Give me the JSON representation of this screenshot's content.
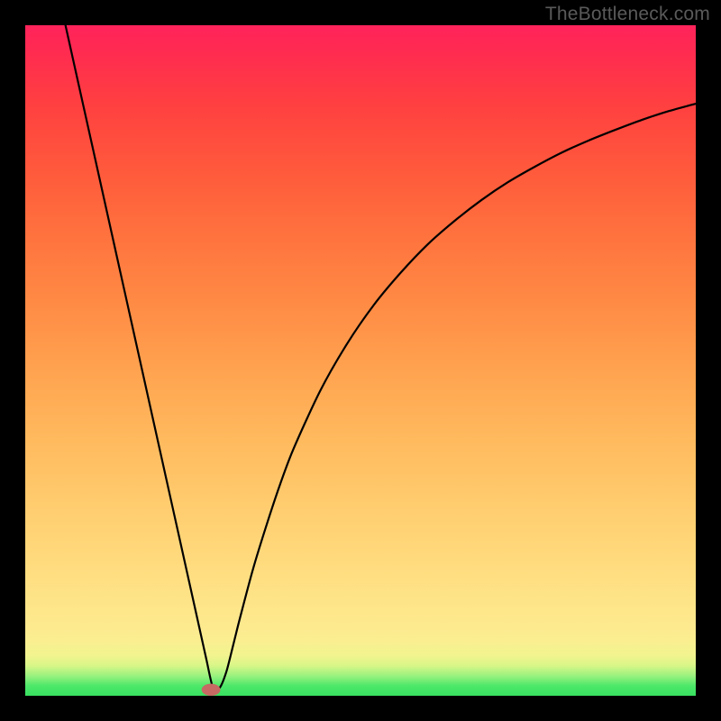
{
  "watermark": "TheBottleneck.com",
  "chart_data": {
    "type": "line",
    "title": "",
    "xlabel": "",
    "ylabel": "",
    "xlim": [
      0,
      100
    ],
    "ylim": [
      0,
      100
    ],
    "axes_visible": false,
    "grid": false,
    "background_gradient": {
      "direction": "bottom-to-top",
      "stops": [
        {
          "pos": 0.0,
          "color": "#38e160"
        },
        {
          "pos": 0.05,
          "color": "#d8f688"
        },
        {
          "pos": 0.1,
          "color": "#fdea8f"
        },
        {
          "pos": 0.3,
          "color": "#ffcd6f"
        },
        {
          "pos": 0.5,
          "color": "#ffa450"
        },
        {
          "pos": 0.7,
          "color": "#ff743e"
        },
        {
          "pos": 0.9,
          "color": "#ff4040"
        },
        {
          "pos": 1.0,
          "color": "#ff235b"
        }
      ]
    },
    "series": [
      {
        "name": "bottleneck-curve",
        "color": "#000000",
        "x": [
          6,
          8,
          10,
          12,
          14,
          16,
          18,
          20,
          22,
          24,
          26,
          27,
          28,
          29,
          30,
          31,
          32,
          34,
          36,
          38,
          40,
          44,
          48,
          52,
          56,
          60,
          64,
          68,
          72,
          76,
          80,
          84,
          88,
          92,
          96,
          100
        ],
        "values": [
          100,
          91,
          82,
          73,
          64,
          55,
          46,
          37,
          28,
          19,
          10,
          5.5,
          1.2,
          1.2,
          3.6,
          7.5,
          11.5,
          19,
          25.5,
          31.5,
          36.8,
          45.5,
          52.5,
          58.3,
          63.1,
          67.3,
          70.8,
          73.9,
          76.6,
          78.9,
          81.0,
          82.8,
          84.4,
          85.9,
          87.2,
          88.3
        ]
      }
    ],
    "markers": [
      {
        "name": "vertex",
        "x": 27.7,
        "y": 0.9,
        "color": "#c66a63",
        "rx": 1.4,
        "ry": 0.9
      }
    ]
  }
}
